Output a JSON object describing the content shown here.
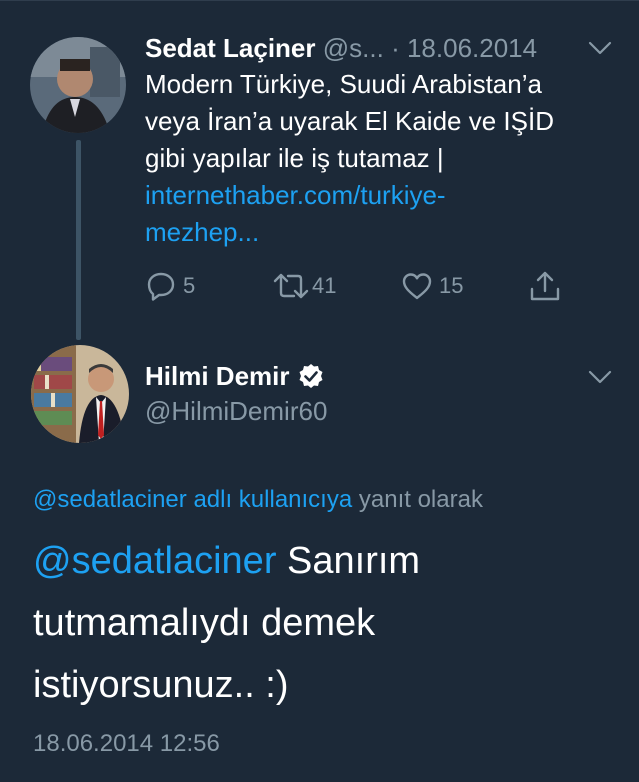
{
  "parent_tweet": {
    "name": "Sedat Laçiner",
    "handle": "@s...",
    "separator": "·",
    "date": "18.06.2014",
    "text_lines": [
      "Modern Türkiye, Suudi Arabistan’a",
      "veya İran’a uyarak El Kaide ve IŞİD",
      "gibi yapılar ile iş tutamaz |"
    ],
    "link_lines": [
      "internethaber.com/turkiye-",
      "mezhep..."
    ],
    "actions": {
      "reply_count": "5",
      "retweet_count": "41",
      "like_count": "15"
    }
  },
  "reply_tweet": {
    "name": "Hilmi Demir",
    "handle": "@HilmiDemir60",
    "reply_context_mention": "@sedatlaciner adlı kullanıcıya",
    "reply_context_suffix": "yanıt olarak",
    "body_mention": "@sedatlaciner",
    "body_line1_rest": "Sanırım",
    "body_line2": "tutmamalıydı demek",
    "body_line3": "istiyorsunuz.. :)",
    "timestamp": "18.06.2014 12:56"
  },
  "colors": {
    "background": "#1c2938",
    "accent": "#1da1f2",
    "muted": "#8899a6",
    "thread_line": "#3d5466"
  },
  "icons": [
    "reply-icon",
    "retweet-icon",
    "like-icon",
    "share-icon",
    "chevron-down-icon",
    "verified-badge-icon"
  ]
}
